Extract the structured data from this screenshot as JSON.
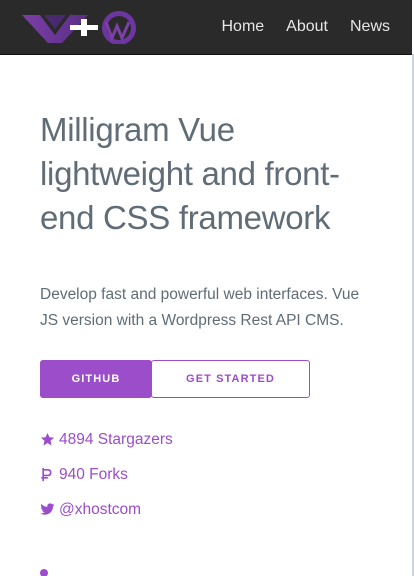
{
  "nav": {
    "links": [
      "Home",
      "About",
      "News"
    ],
    "logo_icon": "vue-wordpress-logo-icon",
    "colors": {
      "bar": "#2a2a2a",
      "link": "#e6e6e6"
    }
  },
  "hero": {
    "title": "Milligram Vue lightweight and front-end CSS framework",
    "description": "Develop fast and powerful web interfaces. Vue JS version with a Wordpress Rest API CMS."
  },
  "buttons": {
    "github": "GITHUB",
    "get_started": "GET STARTED"
  },
  "meta": {
    "stargazers": "4894 Stargazers",
    "forks": "940 Forks",
    "twitter": "@xhostcom"
  },
  "icons": {
    "star": "star-icon",
    "fork": "fork-icon",
    "twitter": "twitter-icon"
  },
  "colors": {
    "accent": "#9b4dca",
    "text": "#606c76",
    "background": "#ffffff"
  }
}
